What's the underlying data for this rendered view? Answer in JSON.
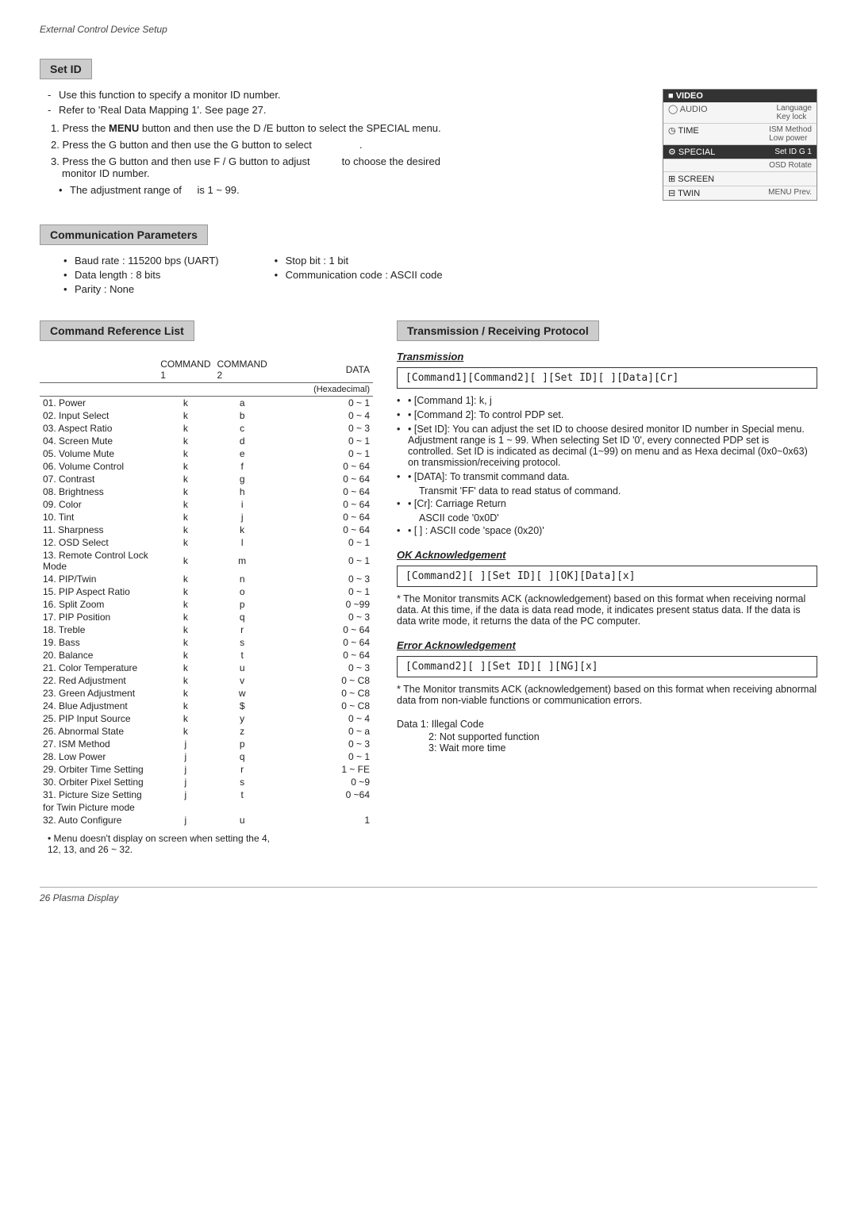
{
  "header": {
    "title": "External Control Device Setup"
  },
  "setId": {
    "sectionTitle": "Set ID",
    "bullets": [
      "Use this function to specify a monitor ID number.",
      "Refer to 'Real Data Mapping 1'. See page 27."
    ],
    "steps": [
      {
        "num": "1.",
        "text": "Press the ",
        "bold": "MENU",
        "after": " button and then use the D / E  button to select the SPECIAL menu."
      },
      {
        "num": "2.",
        "text": "Press the G button and then use the G button to select",
        "after": " ."
      },
      {
        "num": "3.",
        "text": "Press the G button and then use F / G button to adjust",
        "after": " to choose the desired monitor ID number."
      }
    ],
    "adjustNote": "• The adjustment range of        is 1 ~ 99.",
    "menuItems": [
      {
        "label": "VIDEO",
        "side": "",
        "highlighted": false,
        "icon": true
      },
      {
        "label": "AUDIO",
        "side": "Language\nKey lock",
        "highlighted": false
      },
      {
        "label": "TIME",
        "side": "ISM Method\nLow power",
        "highlighted": false
      },
      {
        "label": "SPECIAL",
        "side": "Set ID    G      1",
        "highlighted": true
      },
      {
        "label": "",
        "side": "OSD Rotate",
        "highlighted": false
      },
      {
        "label": "SCREEN",
        "side": "",
        "highlighted": false
      },
      {
        "label": "TWIN",
        "side": "MENU  Prev.",
        "highlighted": false
      }
    ]
  },
  "commParams": {
    "sectionTitle": "Communication Parameters",
    "col1": [
      "Baud rate : 115200 bps (UART)",
      "Data length : 8 bits",
      "Parity : None"
    ],
    "col2": [
      "Stop bit : 1 bit",
      "Communication code : ASCII code"
    ]
  },
  "cmdRefList": {
    "sectionTitle": "Command Reference List",
    "headers": [
      "",
      "COMMAND 1",
      "COMMAND 2",
      "DATA"
    ],
    "dataSubheader": "(Hexadecimal)",
    "rows": [
      {
        "num": "01.",
        "name": "Power",
        "cmd1": "k",
        "cmd2": "a",
        "data": "0 ~ 1"
      },
      {
        "num": "02.",
        "name": "Input Select",
        "cmd1": "k",
        "cmd2": "b",
        "data": "0 ~ 4"
      },
      {
        "num": "03.",
        "name": "Aspect Ratio",
        "cmd1": "k",
        "cmd2": "c",
        "data": "0 ~ 3"
      },
      {
        "num": "04.",
        "name": "Screen Mute",
        "cmd1": "k",
        "cmd2": "d",
        "data": "0 ~ 1"
      },
      {
        "num": "05.",
        "name": "Volume Mute",
        "cmd1": "k",
        "cmd2": "e",
        "data": "0 ~ 1"
      },
      {
        "num": "06.",
        "name": "Volume Control",
        "cmd1": "k",
        "cmd2": "f",
        "data": "0 ~ 64"
      },
      {
        "num": "07.",
        "name": "Contrast",
        "cmd1": "k",
        "cmd2": "g",
        "data": "0 ~ 64"
      },
      {
        "num": "08.",
        "name": "Brightness",
        "cmd1": "k",
        "cmd2": "h",
        "data": "0 ~ 64"
      },
      {
        "num": "09.",
        "name": "Color",
        "cmd1": "k",
        "cmd2": "i",
        "data": "0 ~ 64"
      },
      {
        "num": "10.",
        "name": "Tint",
        "cmd1": "k",
        "cmd2": "j",
        "data": "0 ~ 64"
      },
      {
        "num": "11.",
        "name": "Sharpness",
        "cmd1": "k",
        "cmd2": "k",
        "data": "0 ~ 64"
      },
      {
        "num": "12.",
        "name": "OSD Select",
        "cmd1": "k",
        "cmd2": "l",
        "data": "0 ~ 1"
      },
      {
        "num": "13.",
        "name": "Remote Control Lock Mode",
        "cmd1": "k",
        "cmd2": "m",
        "data": "0 ~ 1"
      },
      {
        "num": "14.",
        "name": "PIP/Twin",
        "cmd1": "k",
        "cmd2": "n",
        "data": "0 ~ 3"
      },
      {
        "num": "15.",
        "name": "PIP Aspect Ratio",
        "cmd1": "k",
        "cmd2": "o",
        "data": "0 ~ 1"
      },
      {
        "num": "16.",
        "name": "Split Zoom",
        "cmd1": "k",
        "cmd2": "p",
        "data": "0 ~99"
      },
      {
        "num": "17.",
        "name": "PIP Position",
        "cmd1": "k",
        "cmd2": "q",
        "data": "0 ~ 3"
      },
      {
        "num": "18.",
        "name": "Treble",
        "cmd1": "k",
        "cmd2": "r",
        "data": "0 ~ 64"
      },
      {
        "num": "19.",
        "name": "Bass",
        "cmd1": "k",
        "cmd2": "s",
        "data": "0 ~ 64"
      },
      {
        "num": "20.",
        "name": "Balance",
        "cmd1": "k",
        "cmd2": "t",
        "data": "0 ~ 64"
      },
      {
        "num": "21.",
        "name": "Color Temperature",
        "cmd1": "k",
        "cmd2": "u",
        "data": "0 ~ 3"
      },
      {
        "num": "22.",
        "name": "Red Adjustment",
        "cmd1": "k",
        "cmd2": "v",
        "data": "0 ~ C8"
      },
      {
        "num": "23.",
        "name": "Green Adjustment",
        "cmd1": "k",
        "cmd2": "w",
        "data": "0 ~ C8"
      },
      {
        "num": "24.",
        "name": "Blue Adjustment",
        "cmd1": "k",
        "cmd2": "$",
        "data": "0 ~ C8"
      },
      {
        "num": "25.",
        "name": "PIP Input Source",
        "cmd1": "k",
        "cmd2": "y",
        "data": "0 ~ 4"
      },
      {
        "num": "26.",
        "name": "Abnormal State",
        "cmd1": "k",
        "cmd2": "z",
        "data": "0 ~ a"
      },
      {
        "num": "27.",
        "name": "ISM Method",
        "cmd1": "j",
        "cmd2": "p",
        "data": "0 ~ 3"
      },
      {
        "num": "28.",
        "name": "Low Power",
        "cmd1": "j",
        "cmd2": "q",
        "data": "0 ~ 1"
      },
      {
        "num": "29.",
        "name": "Orbiter Time Setting",
        "cmd1": "j",
        "cmd2": "r",
        "data": "1 ~ FE"
      },
      {
        "num": "30.",
        "name": "Orbiter Pixel Setting",
        "cmd1": "j",
        "cmd2": "s",
        "data": "0 ~9"
      },
      {
        "num": "31.",
        "name": "Picture Size Setting",
        "cmd1": "j",
        "cmd2": "t",
        "data": "0 ~64"
      },
      {
        "num": "",
        "name": "for Twin Picture mode",
        "cmd1": "",
        "cmd2": "",
        "data": ""
      },
      {
        "num": "32.",
        "name": "Auto Configure",
        "cmd1": "j",
        "cmd2": "u",
        "data": "1"
      }
    ],
    "footnote1": "• Menu doesn't display on screen when setting the 4,",
    "footnote2": "  12, 13, and 26 ~ 32."
  },
  "transmission": {
    "sectionTitle": "Transmission / Receiving  Protocol",
    "transmissionTitle": "Transmission",
    "transmissionBox": "[Command1][Command2][  ][Set ID][  ][Data][Cr]",
    "transmissionNotes": [
      "• [Command 1]: k, j",
      "• [Command 2]: To control PDP set.",
      "• [Set ID]: You can adjust the set ID to choose desired monitor ID number in Special menu. Adjustment range is 1 ~ 99. When selecting Set ID '0', every connected PDP set is controlled. Set ID is indicated as decimal (1~99) on menu and as Hexa decimal (0x0~0x63) on transmission/receiving protocol.",
      "• [DATA]: To transmit command data.",
      "Transmit 'FF' data to read status of command.",
      "• [Cr]: Carriage Return",
      "ASCII code '0x0D'",
      "• [  ] : ASCII code 'space (0x20)'"
    ],
    "okAckTitle": "OK Acknowledgement",
    "okAckBox": "[Command2][  ][Set ID][  ][OK][Data][x]",
    "okAckNote": "* The Monitor transmits ACK (acknowledgement) based on this format when receiving normal data. At this time, if the data is data read mode, it indicates present status data. If the data is data write mode, it returns the data of the PC computer.",
    "errorAckTitle": "Error Acknowledgement",
    "errorAckBox": "[Command2][  ][Set ID][  ][NG][x]",
    "errorAckNote": "* The Monitor transmits ACK (acknowledgement) based on this format when receiving abnormal data from non-viable functions or communication errors.",
    "dataNote": "Data  1: Illegal Code",
    "dataIndent1": "2: Not supported function",
    "dataIndent2": "3: Wait more time"
  },
  "footer": {
    "pageLabel": "26   Plasma Display"
  }
}
